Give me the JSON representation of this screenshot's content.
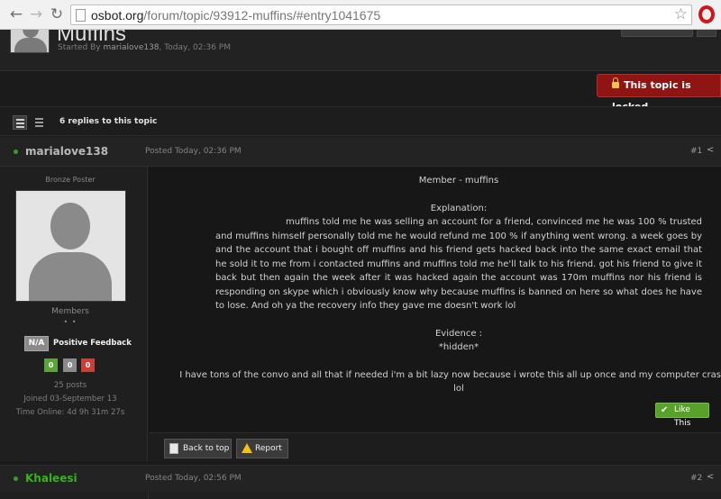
{
  "browser": {
    "url_domain": "osbot.org",
    "url_path": "/forum/topic/93912-muffins/#entry1041675"
  },
  "topic": {
    "title": "Muffins",
    "started_by_prefix": "Started By",
    "started_by_user": "marialove138",
    "started_by_date": ", Today, 02:36 PM",
    "locked_label": "This topic is locked",
    "replies_label": "6 replies to this topic"
  },
  "post1": {
    "author": "marialove138",
    "posted": "Posted Today, 02:36 PM",
    "number": "#1",
    "rank_title": "Bronze Poster",
    "group": "Members",
    "pips": "• •",
    "rep_value": "N/A",
    "rep_label": "Positive Feedback",
    "feedback": {
      "positive": "0",
      "neutral": "0",
      "negative": "0"
    },
    "posts": "25 posts",
    "joined": "Joined 03-September 13",
    "time_online": "Time Online: 4d 9h 31m 27s",
    "body": {
      "line1": "Member - muffins",
      "explanation_heading": "Explanation:",
      "explanation_text": "muffins told me he was selling an account for a friend, convinced me he was 100 % trusted and muffins himself  personally told me he would refund me 100 % if anything went wrong. a week goes by and the account that i bought off muffins and his friend gets hacked back into the same exact email that he sold it to me from i contacted muffins and muffins told me he'll talk to his friend. got his friend to give it back  but then again the week after it was hacked again the account was 170m muffins nor his friend is responding on skype which i obviously know why because muffins is banned on here so what does he have to lose. And oh ya the recovery info they gave me doesn't work lol",
      "evidence_heading": "Evidence :",
      "evidence_value": "*hidden*",
      "closing": "I have tons of the convo and all that if needed i'm a bit lazy now because i wrote this all up once and my computer crashed lol"
    },
    "like_label": "Like This",
    "back_to_top_label": "Back to top",
    "report_label": "Report"
  },
  "post2": {
    "author": "Khaleesi",
    "posted": "Posted Today, 02:56 PM",
    "number": "#2"
  },
  "colors": {
    "locked_bg": "#8e1514",
    "like_green": "#58a12b",
    "online_green": "#3d9a28",
    "author2_green": "#38b21a"
  }
}
